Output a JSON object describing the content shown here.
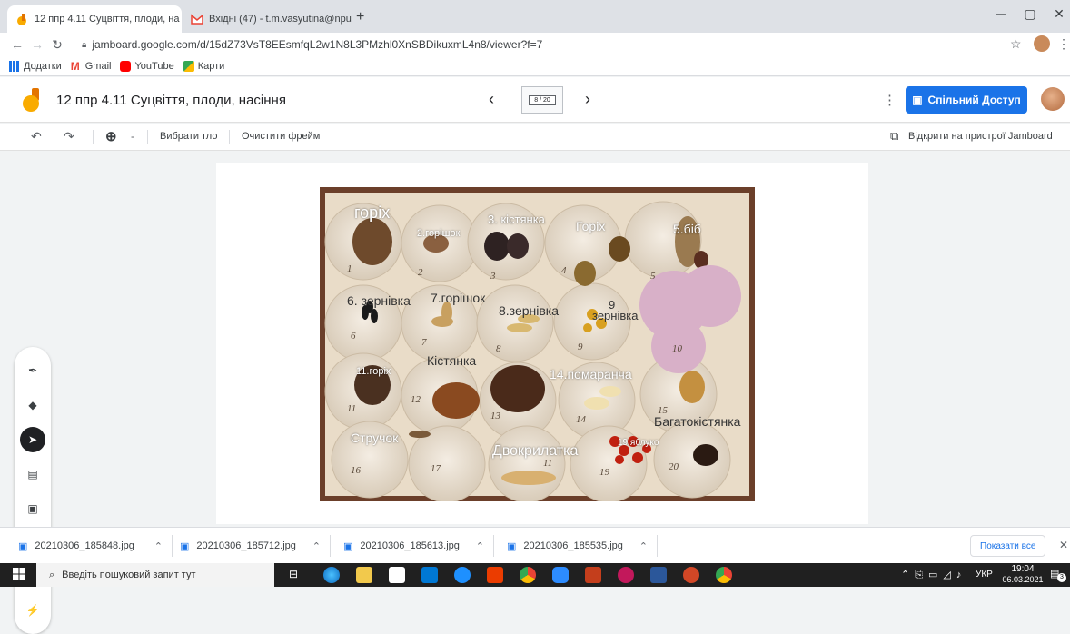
{
  "browser": {
    "tabs": [
      {
        "label": "12 ппр 4.11 Суцвіття, плоди, на",
        "active": true
      },
      {
        "label": "Вхідні (47) - t.m.vasyutina@npu.",
        "active": false
      }
    ],
    "new_tab": "+",
    "url": "jamboard.google.com/d/15dZ73VsT8EEsmfqL2w1N8L3PMzhl0XnSBDikuxmL4n8/viewer?f=7",
    "bookmarks": [
      "Додатки",
      "Gmail",
      "YouTube",
      "Карти"
    ]
  },
  "app": {
    "title": "12 ппр 4.11 Суцвіття, плоди, насіння",
    "frame_indicator": "8 / 20",
    "share_label": "Спільний Доступ",
    "toolbar": {
      "background_label": "Вибрати тло",
      "clear_label": "Очистити фрейм",
      "open_device_label": "Відкрити на пристрої Jamboard",
      "zoom_dropdown": "-"
    }
  },
  "photo_labels": [
    "горіх",
    "2.горішок",
    "3. кістянка",
    "Горіх",
    "5.біб",
    "6. зернівка",
    "7.горішок",
    "8.зернівка",
    "9",
    "зернівка",
    "11.горіх",
    "Кістянка",
    "14.помаранча",
    "Багатокістянка",
    "Стручок",
    "Двокрилатка",
    "19.яблуко"
  ],
  "photo_numbers": [
    "1",
    "2",
    "3",
    "4",
    "5",
    "6",
    "7",
    "8",
    "9",
    "10",
    "11",
    "12",
    "13",
    "14",
    "15",
    "16",
    "17",
    "11",
    "19",
    "20"
  ],
  "downloads": [
    "20210306_185848.jpg",
    "20210306_185712.jpg",
    "20210306_185613.jpg",
    "20210306_185535.jpg"
  ],
  "downloads_show_all": "Показати все",
  "taskbar": {
    "search_placeholder": "Введіть пошуковий запит тут",
    "lang": "УКР",
    "time": "19:04",
    "date": "06.03.2021",
    "notif_count": "3"
  },
  "colors": {
    "share_button": "#1a73e8",
    "jamboard_logo": "#f9ab00",
    "taskbar": "#202020"
  }
}
